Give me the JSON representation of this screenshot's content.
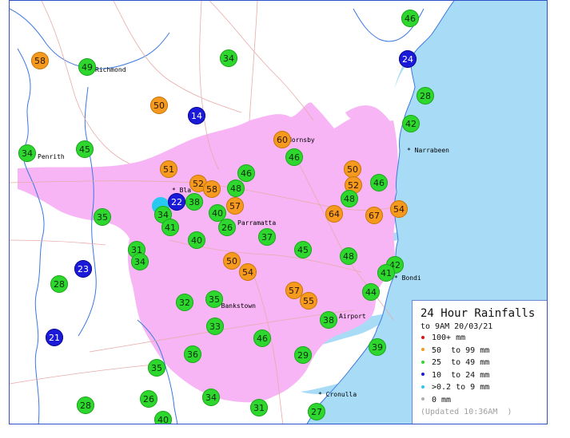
{
  "legend": {
    "title": "24 Hour Rainfalls",
    "subtitle": "to 9AM 20/03/21",
    "items": [
      {
        "label": "100+ mm",
        "color": "#e01010"
      },
      {
        "label": "50  to 99 mm",
        "color": "#f59a1e"
      },
      {
        "label": "25  to 49 mm",
        "color": "#2ed72e"
      },
      {
        "label": "10  to 24 mm",
        "color": "#1a1ad8"
      },
      {
        "label": ">0.2 to 9 mm",
        "color": "#28c8f0"
      },
      {
        "label": "0 mm",
        "color": "#b0b0b0"
      }
    ],
    "updated": "(Updated 10:36AM  )"
  },
  "places": [
    "Richmond",
    "Penrith",
    "Hornsby",
    "Narrabeen",
    "Bla",
    "Parramatta",
    "Bondi",
    "Bankstown",
    "Airport",
    "Cronulla"
  ],
  "rainfall_readings": [
    {
      "value": 46,
      "category": "25-49"
    },
    {
      "value": 58,
      "category": "50-99"
    },
    {
      "value": 49,
      "category": "25-49"
    },
    {
      "value": 34,
      "category": "25-49"
    },
    {
      "value": 24,
      "category": "10-24"
    },
    {
      "value": 28,
      "category": "25-49"
    },
    {
      "value": 50,
      "category": "50-99"
    },
    {
      "value": 14,
      "category": "10-24"
    },
    {
      "value": 42,
      "category": "25-49"
    },
    {
      "value": 60,
      "category": "50-99"
    },
    {
      "value": 34,
      "category": "25-49"
    },
    {
      "value": 45,
      "category": "25-49"
    },
    {
      "value": 46,
      "category": "25-49"
    },
    {
      "value": 51,
      "category": "50-99"
    },
    {
      "value": 50,
      "category": "50-99"
    },
    {
      "value": 46,
      "category": "25-49"
    },
    {
      "value": 46,
      "category": "25-49"
    },
    {
      "value": 52,
      "category": "50-99"
    },
    {
      "value": 58,
      "category": "50-99"
    },
    {
      "value": 48,
      "category": "25-49"
    },
    {
      "value": 52,
      "category": "50-99"
    },
    {
      "value": 22,
      "category": "10-24"
    },
    {
      "value": 38,
      "category": "25-49"
    },
    {
      "value": 48,
      "category": "25-49"
    },
    {
      "value": 57,
      "category": "50-99"
    },
    {
      "value": 64,
      "category": "50-99"
    },
    {
      "value": 67,
      "category": "50-99"
    },
    {
      "value": 54,
      "category": "50-99"
    },
    {
      "value": 40,
      "category": "25-49"
    },
    {
      "value": 34,
      "category": "25-49"
    },
    {
      "value": 35,
      "category": "25-49"
    },
    {
      "value": 41,
      "category": "25-49"
    },
    {
      "value": 26,
      "category": "25-49"
    },
    {
      "value": 40,
      "category": "25-49"
    },
    {
      "value": 37,
      "category": "25-49"
    },
    {
      "value": 31,
      "category": "25-49"
    },
    {
      "value": 34,
      "category": "25-49"
    },
    {
      "value": 45,
      "category": "25-49"
    },
    {
      "value": 48,
      "category": "25-49"
    },
    {
      "value": 42,
      "category": "25-49"
    },
    {
      "value": 41,
      "category": "25-49"
    },
    {
      "value": 23,
      "category": "10-24"
    },
    {
      "value": 50,
      "category": "50-99"
    },
    {
      "value": 54,
      "category": "50-99"
    },
    {
      "value": 28,
      "category": "25-49"
    },
    {
      "value": 57,
      "category": "50-99"
    },
    {
      "value": 55,
      "category": "50-99"
    },
    {
      "value": 44,
      "category": "25-49"
    },
    {
      "value": 32,
      "category": "25-49"
    },
    {
      "value": 35,
      "category": "25-49"
    },
    {
      "value": 38,
      "category": "25-49"
    },
    {
      "value": 33,
      "category": "25-49"
    },
    {
      "value": 21,
      "category": "10-24"
    },
    {
      "value": 46,
      "category": "25-49"
    },
    {
      "value": 39,
      "category": "25-49"
    },
    {
      "value": 36,
      "category": "25-49"
    },
    {
      "value": 29,
      "category": "25-49"
    },
    {
      "value": 35,
      "category": "25-49"
    },
    {
      "value": 26,
      "category": "25-49"
    },
    {
      "value": 34,
      "category": "25-49"
    },
    {
      "value": 28,
      "category": "25-49"
    },
    {
      "value": 31,
      "category": "25-49"
    },
    {
      "value": 27,
      "category": "25-49"
    },
    {
      "value": 40,
      "category": "25-49"
    },
    {
      "value": null,
      "category": ">0.2-9"
    }
  ]
}
